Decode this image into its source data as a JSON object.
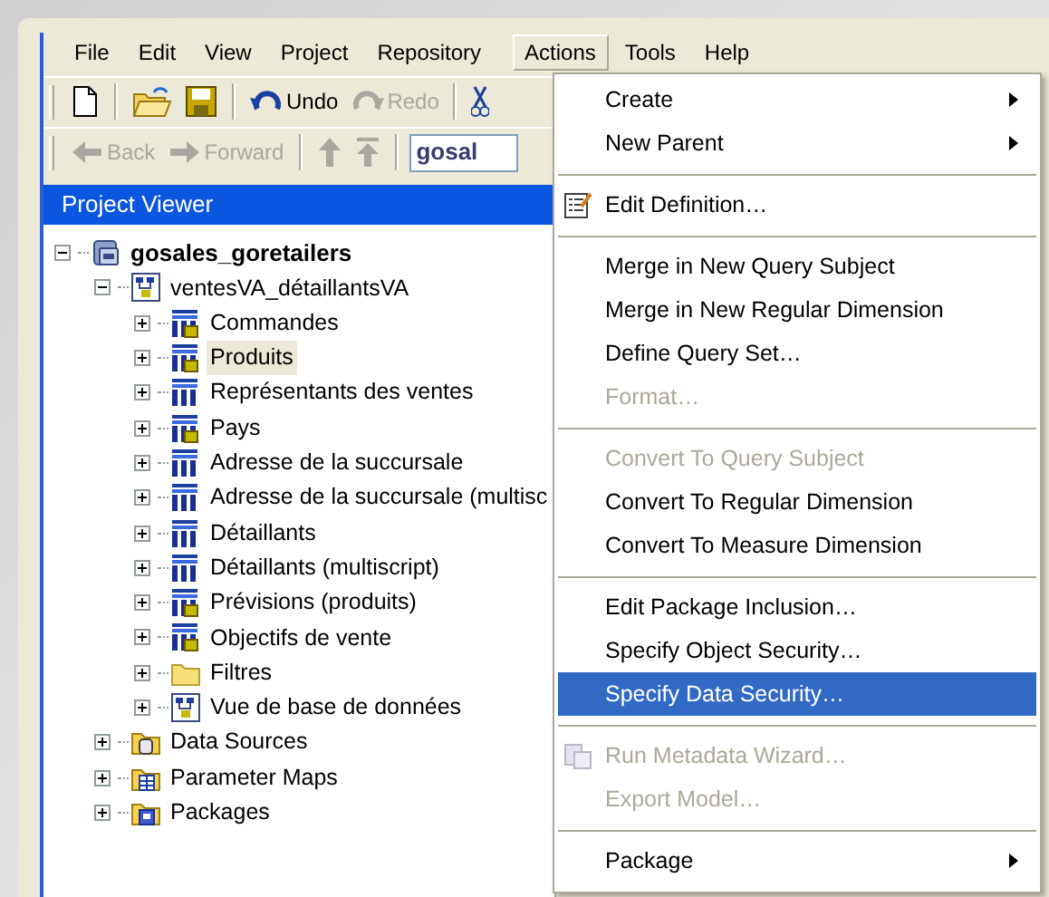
{
  "menu_bar": [
    {
      "label": "File",
      "selected": false
    },
    {
      "label": "Edit",
      "selected": false
    },
    {
      "label": "View",
      "selected": false
    },
    {
      "label": "Project",
      "selected": false
    },
    {
      "label": "Repository",
      "selected": false
    },
    {
      "label": "Actions",
      "selected": true
    },
    {
      "label": "Tools",
      "selected": false
    },
    {
      "label": "Help",
      "selected": false
    }
  ],
  "toolbar_1": [
    {
      "kind": "new"
    },
    {
      "kind": "separator"
    },
    {
      "kind": "open"
    },
    {
      "kind": "save"
    },
    {
      "kind": "separator"
    },
    {
      "kind": "undo",
      "label": "Undo",
      "disabled": false
    },
    {
      "kind": "redo",
      "label": "Redo",
      "disabled": true
    },
    {
      "kind": "separator"
    },
    {
      "kind": "cut"
    }
  ],
  "toolbar_2": [
    {
      "kind": "back",
      "label": "Back",
      "disabled": true
    },
    {
      "kind": "forward",
      "label": "Forward",
      "disabled": true
    },
    {
      "kind": "separator"
    },
    {
      "kind": "up",
      "disabled": true
    },
    {
      "kind": "top",
      "disabled": true
    },
    {
      "kind": "separator"
    },
    {
      "kind": "combo",
      "value": "gosal"
    }
  ],
  "project_viewer": {
    "title": "Project Viewer",
    "tree": [
      {
        "kind": "project",
        "label": "gosales_goretailers",
        "expanded": true,
        "selected": false,
        "children": [
          {
            "kind": "namespace",
            "label": "ventesVA_détaillantsVA",
            "expanded": true,
            "selected": false,
            "children": [
              {
                "kind": "dimension",
                "label": "Commandes",
                "expanded": false,
                "selected": false
              },
              {
                "kind": "dimension",
                "label": "Produits",
                "expanded": false,
                "selected": true
              },
              {
                "kind": "query_subject",
                "label": "Représentants des ventes",
                "expanded": false,
                "selected": false
              },
              {
                "kind": "dimension",
                "label": "Pays",
                "expanded": false,
                "selected": false
              },
              {
                "kind": "query_subject",
                "label": "Adresse de la succursale",
                "expanded": false,
                "selected": false
              },
              {
                "kind": "query_subject",
                "label": "Adresse de la succursale (multisc",
                "expanded": false,
                "selected": false
              },
              {
                "kind": "query_subject",
                "label": "Détaillants",
                "expanded": false,
                "selected": false
              },
              {
                "kind": "query_subject",
                "label": "Détaillants (multiscript)",
                "expanded": false,
                "selected": false
              },
              {
                "kind": "dimension",
                "label": "Prévisions (produits)",
                "expanded": false,
                "selected": false
              },
              {
                "kind": "dimension",
                "label": "Objectifs de vente",
                "expanded": false,
                "selected": false
              },
              {
                "kind": "folder",
                "label": "Filtres",
                "expanded": false,
                "selected": false
              },
              {
                "kind": "namespace",
                "label": "Vue de base de données",
                "expanded": false,
                "selected": false
              }
            ]
          },
          {
            "kind": "data_sources",
            "label": "Data Sources",
            "expanded": false,
            "selected": false
          },
          {
            "kind": "parameter_maps",
            "label": "Parameter Maps",
            "expanded": false,
            "selected": false
          },
          {
            "kind": "packages",
            "label": "Packages",
            "expanded": false,
            "selected": false
          }
        ]
      }
    ]
  },
  "actions_menu": [
    {
      "kind": "item",
      "label": "Create",
      "disabled": false,
      "selected": false,
      "submenu": true,
      "has_icon": false
    },
    {
      "kind": "item",
      "label": "New Parent",
      "disabled": false,
      "selected": false,
      "submenu": true,
      "has_icon": false
    },
    {
      "kind": "separator"
    },
    {
      "kind": "item",
      "label": "Edit Definition…",
      "disabled": false,
      "selected": false,
      "submenu": false,
      "has_icon": true
    },
    {
      "kind": "separator"
    },
    {
      "kind": "item",
      "label": "Merge in New Query Subject",
      "disabled": false,
      "selected": false,
      "submenu": false,
      "has_icon": false
    },
    {
      "kind": "item",
      "label": "Merge in New Regular Dimension",
      "disabled": false,
      "selected": false,
      "submenu": false,
      "has_icon": false
    },
    {
      "kind": "item",
      "label": "Define Query Set…",
      "disabled": false,
      "selected": false,
      "submenu": false,
      "has_icon": false
    },
    {
      "kind": "item",
      "label": "Format…",
      "disabled": true,
      "selected": false,
      "submenu": false,
      "has_icon": false
    },
    {
      "kind": "separator"
    },
    {
      "kind": "item",
      "label": "Convert To Query Subject",
      "disabled": true,
      "selected": false,
      "submenu": false,
      "has_icon": false
    },
    {
      "kind": "item",
      "label": "Convert To Regular Dimension",
      "disabled": false,
      "selected": false,
      "submenu": false,
      "has_icon": false
    },
    {
      "kind": "item",
      "label": "Convert To Measure Dimension",
      "disabled": false,
      "selected": false,
      "submenu": false,
      "has_icon": false
    },
    {
      "kind": "separator"
    },
    {
      "kind": "item",
      "label": "Edit Package Inclusion…",
      "disabled": false,
      "selected": false,
      "submenu": false,
      "has_icon": false
    },
    {
      "kind": "item",
      "label": "Specify Object Security…",
      "disabled": false,
      "selected": false,
      "submenu": false,
      "has_icon": false
    },
    {
      "kind": "item",
      "label": "Specify Data Security…",
      "disabled": false,
      "selected": true,
      "submenu": false,
      "has_icon": false
    },
    {
      "kind": "separator"
    },
    {
      "kind": "item",
      "label": "Run Metadata Wizard…",
      "disabled": true,
      "selected": false,
      "submenu": false,
      "has_icon": true
    },
    {
      "kind": "item",
      "label": "Export Model…",
      "disabled": true,
      "selected": false,
      "submenu": false,
      "has_icon": false
    },
    {
      "kind": "separator"
    },
    {
      "kind": "item",
      "label": "Package",
      "disabled": false,
      "selected": false,
      "submenu": true,
      "has_icon": false
    }
  ]
}
